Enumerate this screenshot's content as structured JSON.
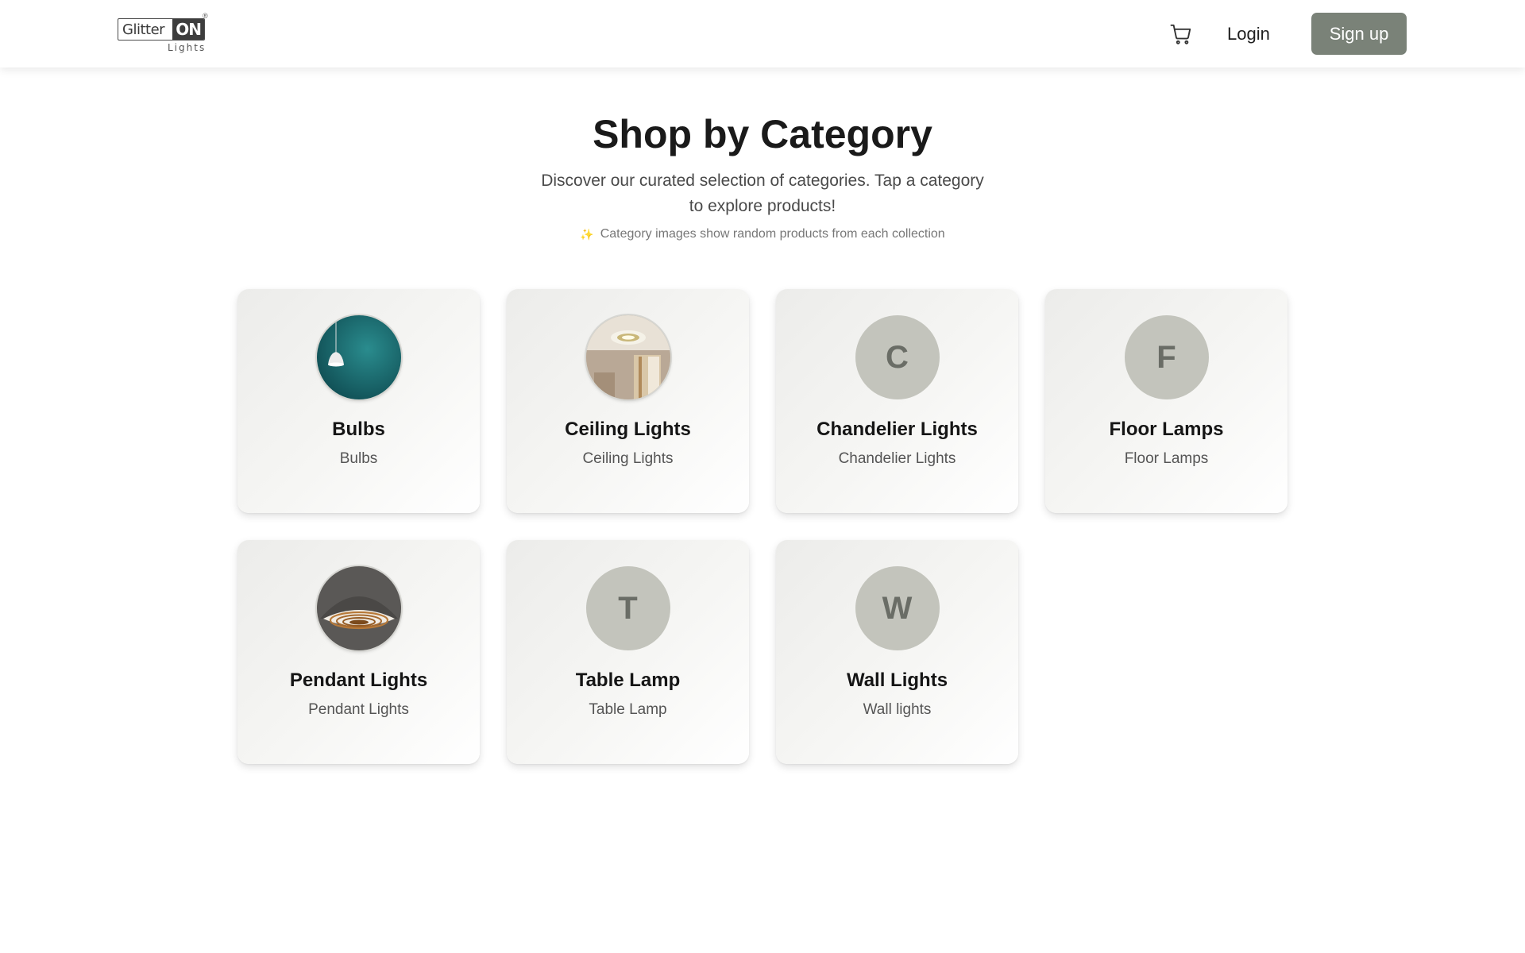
{
  "header": {
    "logo": {
      "brand": "Glitter",
      "brand_highlight": "ON",
      "registered": "®",
      "tagline": "Lights"
    },
    "cart_icon": "shopping-cart-icon",
    "login_label": "Login",
    "signup_label": "Sign up"
  },
  "intro": {
    "title": "Shop by Category",
    "subtitle": "Discover our curated selection of categories. Tap a category to explore products!",
    "note_icon": "sparkle-icon",
    "note": "Category images show random products from each collection"
  },
  "categories": [
    {
      "title": "Bulbs",
      "subtitle": "Bulbs",
      "image": "pendant-lamp-teal-photo"
    },
    {
      "title": "Ceiling Lights",
      "subtitle": "Ceiling Lights",
      "image": "ceiling-light-room-photo"
    },
    {
      "title": "Chandelier Lights",
      "subtitle": "Chandelier Lights",
      "letter": "C"
    },
    {
      "title": "Floor Lamps",
      "subtitle": "Floor Lamps",
      "letter": "F"
    },
    {
      "title": "Pendant Lights",
      "subtitle": "Pendant Lights",
      "image": "dome-pendant-photo"
    },
    {
      "title": "Table Lamp",
      "subtitle": "Table Lamp",
      "letter": "T"
    },
    {
      "title": "Wall Lights",
      "subtitle": "Wall lights",
      "letter": "W"
    }
  ],
  "colors": {
    "primary_button": "#7a8278",
    "avatar_placeholder": "#c3c4bc",
    "avatar_letter": "#6a6d66"
  }
}
